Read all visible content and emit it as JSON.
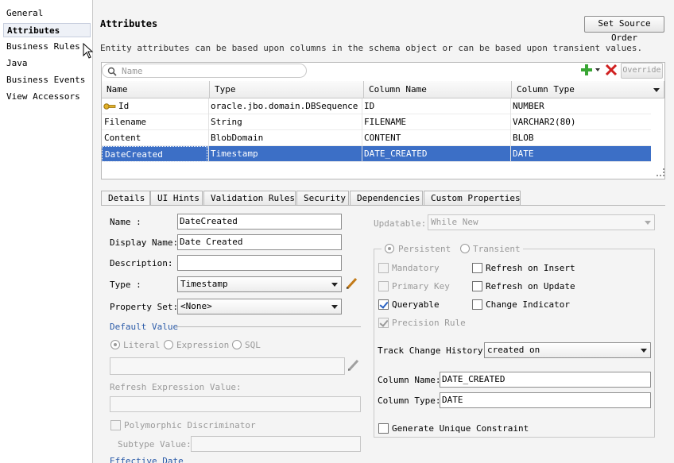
{
  "nav": {
    "items": [
      {
        "label": "General",
        "selected": false
      },
      {
        "label": "Attributes",
        "selected": true
      },
      {
        "label": "Business Rules",
        "selected": false
      },
      {
        "label": "Java",
        "selected": false
      },
      {
        "label": "Business Events",
        "selected": false
      },
      {
        "label": "View Accessors",
        "selected": false
      }
    ]
  },
  "header": {
    "title": "Attributes",
    "set_source_order": "Set Source Order",
    "description": "Entity attributes can be based upon columns in the schema object or can be based upon transient values."
  },
  "toolbar": {
    "search_placeholder": "Name",
    "override": "Override",
    "add_icon": "green-plus-icon",
    "delete_icon": "red-x-icon"
  },
  "table": {
    "columns": [
      "Name",
      "Type",
      "Column Name",
      "Column Type"
    ],
    "rows": [
      {
        "name": "Id",
        "type": "oracle.jbo.domain.DBSequence",
        "column_name": "ID",
        "column_type": "NUMBER",
        "key": true
      },
      {
        "name": "Filename",
        "type": "String",
        "column_name": "FILENAME",
        "column_type": "VARCHAR2(80)"
      },
      {
        "name": "Content",
        "type": "BlobDomain",
        "column_name": "CONTENT",
        "column_type": "BLOB"
      },
      {
        "name": "DateCreated",
        "type": "Timestamp",
        "column_name": "DATE_CREATED",
        "column_type": "DATE",
        "selected": true
      }
    ]
  },
  "tabs": [
    "Details",
    "UI Hints",
    "Validation Rules",
    "Security",
    "Dependencies",
    "Custom Properties"
  ],
  "details": {
    "name_label": "Name :",
    "name_value": "DateCreated",
    "display_name_label": "Display Name:",
    "display_name_value": "Date Created",
    "description_label": "Description:",
    "description_value": "",
    "type_label": "Type :",
    "type_value": "Timestamp",
    "property_set_label": "Property Set:",
    "property_set_value": "<None>",
    "default_value_label": "Default Value",
    "literal": "Literal",
    "expression": "Expression",
    "sql": "SQL",
    "refresh_expression_label": "Refresh Expression Value:",
    "polymorphic": "Polymorphic Discriminator",
    "subtype_value_label": "Subtype Value:",
    "effective_date_label": "Effective Date"
  },
  "right": {
    "updatable_label": "Updatable:",
    "updatable_value": "While New",
    "persistent": "Persistent",
    "transient": "Transient",
    "mandatory": "Mandatory",
    "primary_key": "Primary Key",
    "queryable": "Queryable",
    "precision_rule": "Precision Rule",
    "refresh_on_insert": "Refresh on Insert",
    "refresh_on_update": "Refresh on Update",
    "change_indicator": "Change Indicator",
    "track_change_label": "Track Change History:",
    "track_change_value": "created on",
    "column_name_label": "Column Name:",
    "column_name_value": "DATE_CREATED",
    "column_type_label": "Column Type:",
    "column_type_value": "DATE",
    "generate_unique": "Generate Unique Constraint"
  }
}
